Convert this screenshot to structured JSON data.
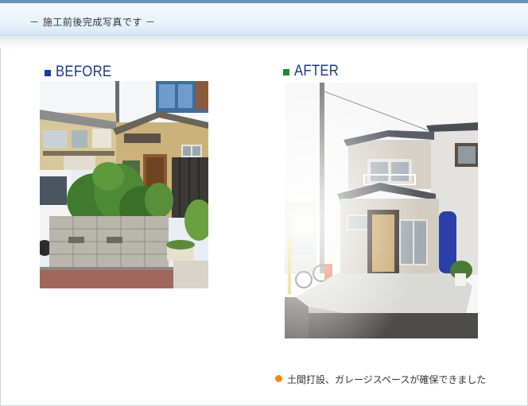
{
  "header": {
    "title": "－ 施工前後完成写真です －"
  },
  "before": {
    "label": "BEFORE",
    "marker_color": "#1a3aa0"
  },
  "after": {
    "label": "AFTER",
    "marker_color": "#1c8a2a"
  },
  "caption": {
    "text": "土間打設、ガレージスペースが確保できました",
    "bullet_color": "#f08a1c"
  }
}
